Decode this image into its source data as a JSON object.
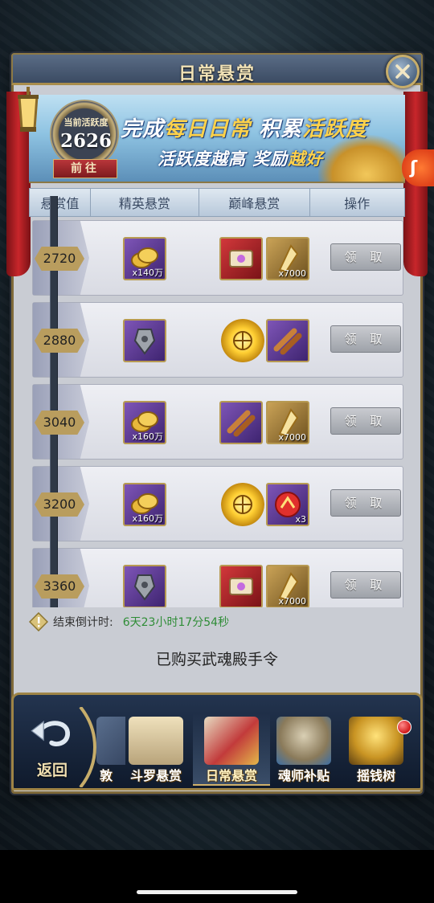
{
  "header": {
    "title": "日常悬赏",
    "close_icon": "close-icon"
  },
  "banner": {
    "activity_label": "当前活跃度",
    "activity_value": "2626",
    "goto_label": "前往",
    "slogan_line1_a": "完成",
    "slogan_line1_b": "每日日常",
    "slogan_line1_c": " 积累",
    "slogan_line1_d": "活跃度",
    "slogan_line2_a": "活跃度越高 奖励",
    "slogan_line2_b": "越好"
  },
  "table": {
    "headers": [
      "悬赏值",
      "精英悬赏",
      "巅峰悬赏",
      "操作"
    ],
    "rows": [
      {
        "value": "2720",
        "elite_qty": "x140万",
        "peak1_qty": "",
        "peak2_qty": "x7000",
        "action": "领 取"
      },
      {
        "value": "2880",
        "elite_qty": "",
        "peak1_qty": "",
        "peak2_qty": "",
        "action": "领 取"
      },
      {
        "value": "3040",
        "elite_qty": "x160万",
        "peak1_qty": "",
        "peak2_qty": "x7000",
        "action": "领 取"
      },
      {
        "value": "3200",
        "elite_qty": "x160万",
        "peak1_qty": "",
        "peak2_qty": "x3",
        "action": "领 取"
      },
      {
        "value": "3360",
        "elite_qty": "",
        "peak1_qty": "",
        "peak2_qty": "x7000",
        "action": "领 取"
      }
    ]
  },
  "countdown": {
    "label": "结束倒计时:",
    "value": "6天23小时17分54秒"
  },
  "status_text": "已购买武魂殿手令",
  "nav": {
    "back_label": "返回",
    "partial_label": "敦",
    "tabs": [
      "斗罗悬赏",
      "日常悬赏",
      "魂师补贴",
      "摇钱树"
    ],
    "active_tab": "日常悬赏"
  },
  "colors": {
    "accent_gold": "#b79a52",
    "countdown_green": "#2f8d37",
    "button_gray": "#9ea2a9"
  }
}
